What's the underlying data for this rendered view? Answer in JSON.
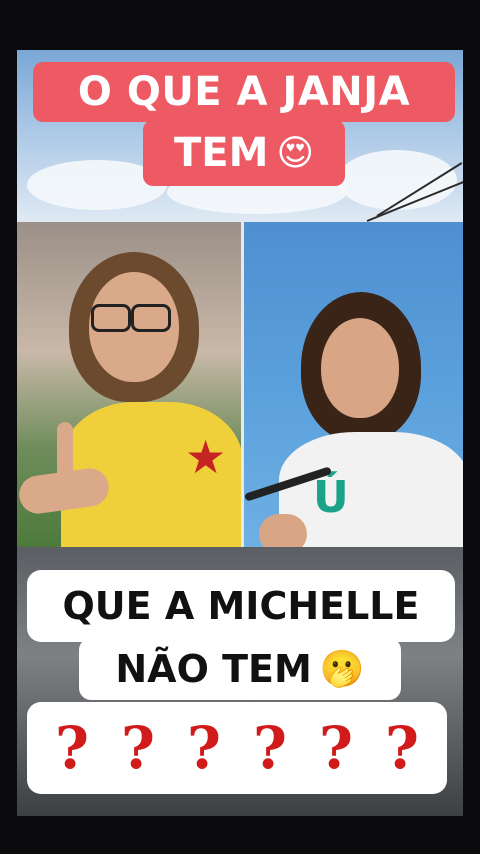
{
  "caption_top": {
    "line1": "O QUE A JANJA",
    "line2": "TEM",
    "emoji": "😍",
    "bg_color": "#ee5a64",
    "text_color": "#ffffff"
  },
  "caption_middle": {
    "line1": "QUE A MICHELLE",
    "line2": "NÃO TEM",
    "emoji": "🫢",
    "bg_color": "#ffffff",
    "text_color": "#111111"
  },
  "caption_bottom": {
    "marks": [
      "?",
      "?",
      "?",
      "?",
      "?",
      "?"
    ],
    "color": "#d11a1a"
  }
}
